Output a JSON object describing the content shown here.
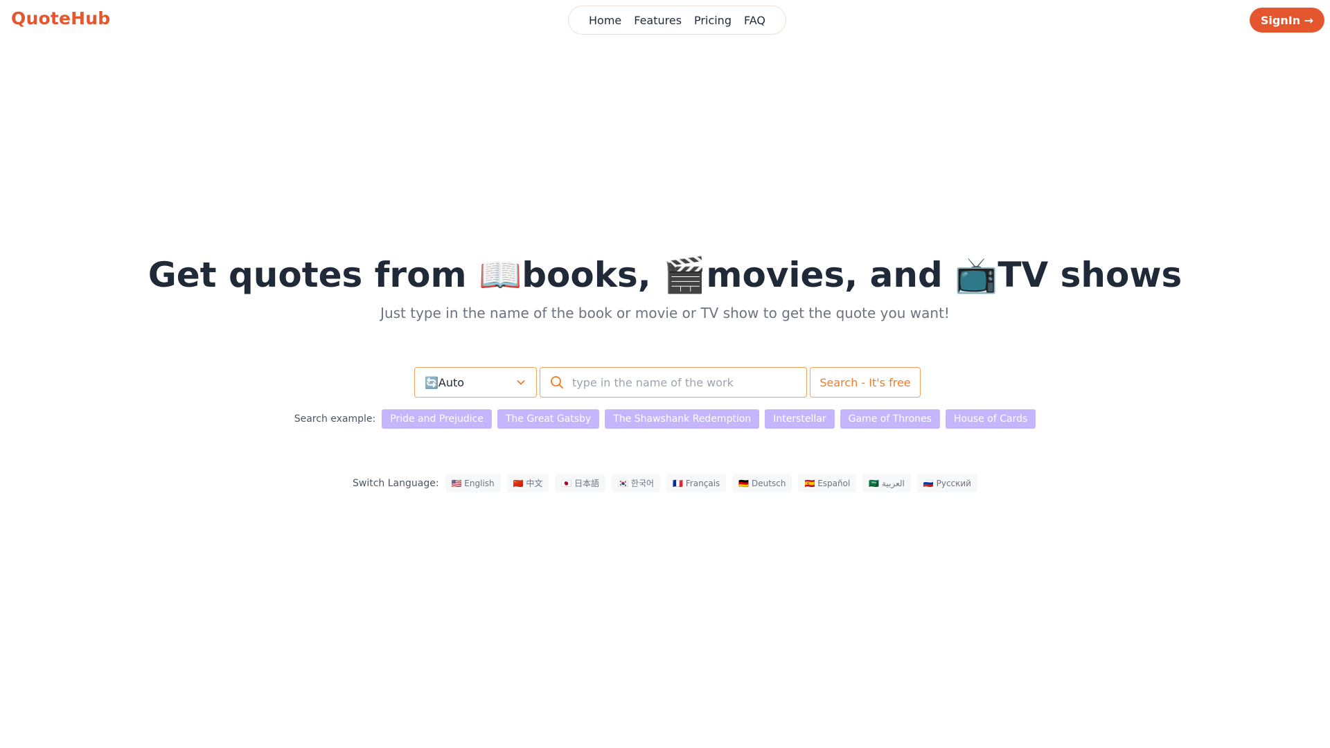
{
  "brand": {
    "name": "QuoteHub",
    "color": "#e4572e"
  },
  "nav": {
    "items": [
      {
        "label": "Home"
      },
      {
        "label": "Features"
      },
      {
        "label": "Pricing"
      },
      {
        "label": "FAQ"
      }
    ]
  },
  "header": {
    "signin_label": "SignIn →"
  },
  "hero": {
    "title": "Get quotes from 📖books, 🎬movies, and 📺TV shows",
    "subtitle": "Just type in the name of the book or movie or TV show to get the quote you want!"
  },
  "search": {
    "type_select_value": "🔄Auto",
    "input_value": "",
    "placeholder": "type in the name of the work",
    "button_label": "Search - It's free",
    "accent_color": "#f5a35c"
  },
  "examples": {
    "label": "Search example:",
    "items": [
      {
        "label": "Pride and Prejudice"
      },
      {
        "label": "The Great Gatsby"
      },
      {
        "label": "The Shawshank Redemption"
      },
      {
        "label": "Interstellar"
      },
      {
        "label": "Game of Thrones"
      },
      {
        "label": "House of Cards"
      }
    ],
    "chip_color": "#c4b5fd"
  },
  "languages": {
    "label": "Switch Language:",
    "items": [
      {
        "label": "🇺🇸 English"
      },
      {
        "label": "🇨🇳 中文"
      },
      {
        "label": "🇯🇵 日本語"
      },
      {
        "label": "🇰🇷 한국어"
      },
      {
        "label": "🇫🇷 Français"
      },
      {
        "label": "🇩🇪 Deutsch"
      },
      {
        "label": "🇪🇸 Español"
      },
      {
        "label": "🇸🇦 العربية"
      },
      {
        "label": "🇷🇺 Русский"
      }
    ]
  }
}
